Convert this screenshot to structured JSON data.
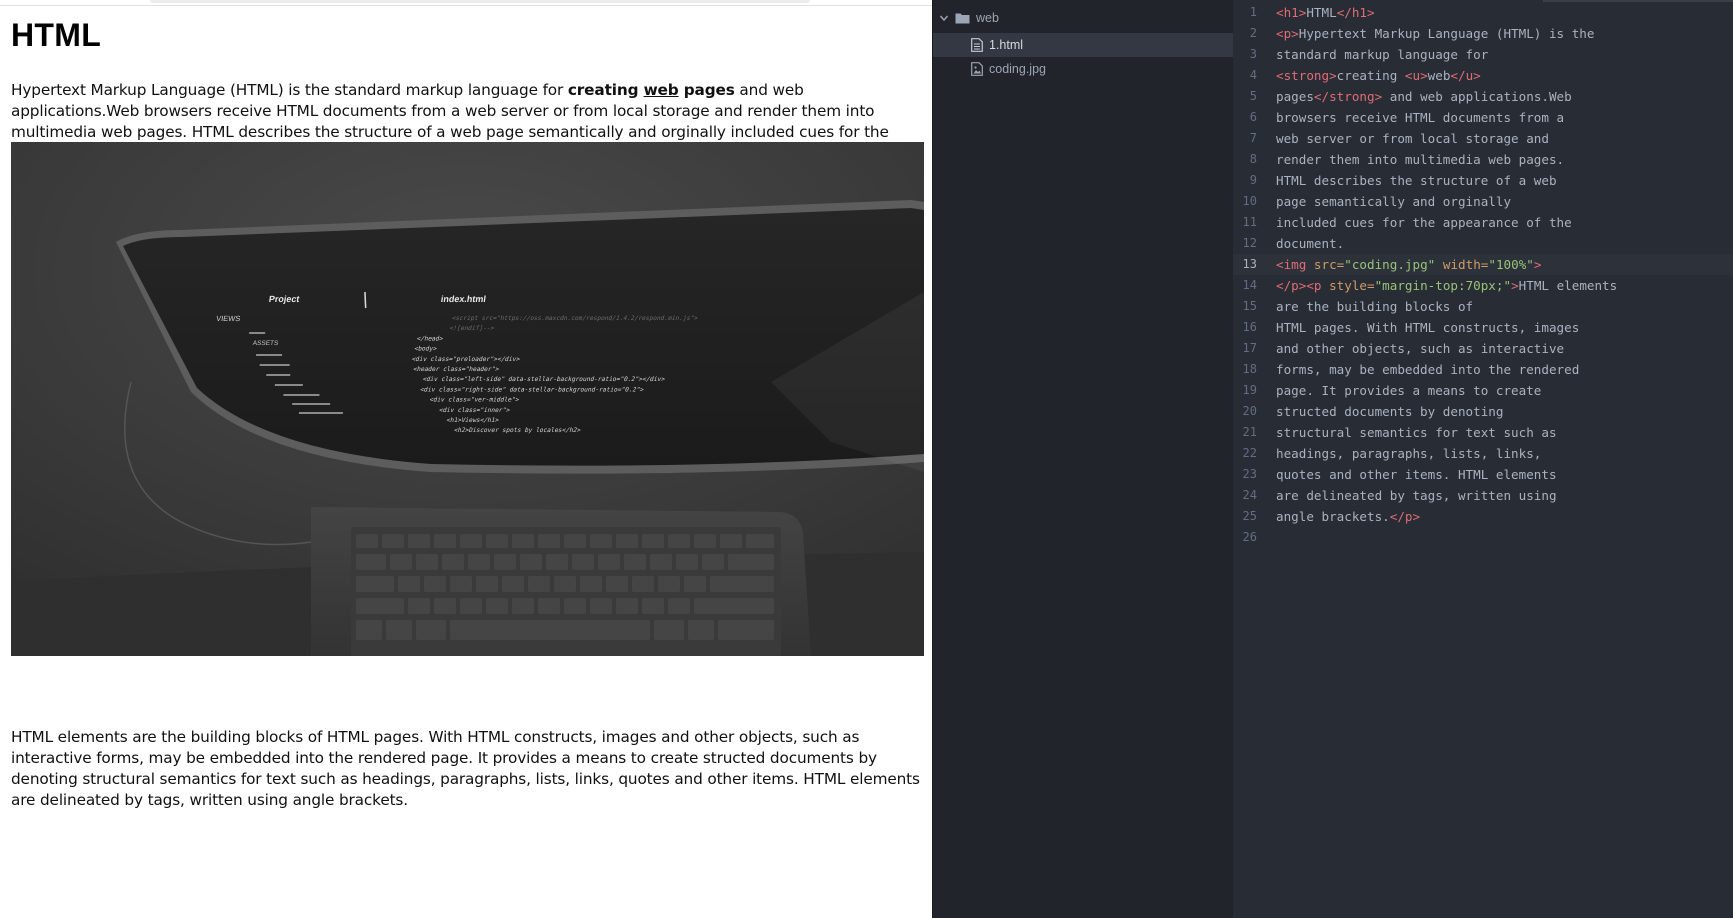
{
  "preview": {
    "title": "HTML",
    "para1": {
      "before": "Hypertext Markup Language (HTML) is the standard markup language for ",
      "strong_a": "creating ",
      "underlined": "web",
      "strong_b": " pages",
      "after": " and web applications.Web browsers receive HTML documents from a web server or from local storage and render them into multimedia web pages. HTML describes the structure of a web page semantically and orginally included cues for the appearance of the document."
    },
    "image_screen": {
      "project_label": "Project",
      "views_label": "VIEWS",
      "assets_label": "ASSETS",
      "file_label": "index.html",
      "code_lines": [
        "<script src=\"https://oss.maxcdn.com/respond/1.4.2/respond.min.js\">",
        "<![endif]-->",
        "</head>",
        "<body>",
        "<div class=\"preloader\"></div>",
        "<header class=\"header\">",
        "<div class=\"left-side\" data-stellar-background-ratio=\"0.2\"></div>",
        "<div class=\"right-side\" data-stellar-background-ratio=\"0.2\">",
        "<div class=\"ver-middle\">",
        "<div class=\"inner\">",
        "<h1>Views</h1>",
        "<h2>Discover spots by locales</h2>"
      ]
    },
    "para2": "HTML elements are the building blocks of HTML pages. With HTML constructs, images and other objects, such as interactive forms, may be embedded into the rendered page. It provides a means to create structed documents by denoting structural semantics for text such as headings, paragraphs, lists, links, quotes and other items. HTML elements are delineated by tags, written using angle brackets."
  },
  "tree": {
    "folder": "web",
    "files": [
      "1.html",
      "coding.jpg"
    ],
    "selected": "1.html"
  },
  "editor": {
    "active_line": 13,
    "lines": [
      {
        "n": "1",
        "segs": [
          [
            "t",
            "<h1>"
          ],
          [
            "x",
            "HTML"
          ],
          [
            "t",
            "</h1>"
          ]
        ]
      },
      {
        "n": "2",
        "segs": [
          [
            "t",
            "<p>"
          ],
          [
            "x",
            "Hypertext Markup Language (HTML) is the"
          ]
        ]
      },
      {
        "n": "3",
        "segs": [
          [
            "x",
            "standard markup language for"
          ]
        ]
      },
      {
        "n": "4",
        "segs": [
          [
            "t",
            "<strong>"
          ],
          [
            "x",
            "creating "
          ],
          [
            "t",
            "<u>"
          ],
          [
            "x",
            "web"
          ],
          [
            "t",
            "</u>"
          ]
        ]
      },
      {
        "n": "5",
        "segs": [
          [
            "x",
            "pages"
          ],
          [
            "t",
            "</strong>"
          ],
          [
            "x",
            " and web applications.Web"
          ]
        ]
      },
      {
        "n": "6",
        "segs": [
          [
            "x",
            "browsers receive HTML documents from a"
          ]
        ]
      },
      {
        "n": "7",
        "segs": [
          [
            "x",
            "web server or from local storage and"
          ]
        ]
      },
      {
        "n": "8",
        "segs": [
          [
            "x",
            "render them into multimedia web pages."
          ]
        ]
      },
      {
        "n": "9",
        "segs": [
          [
            "x",
            "HTML describes the structure of a web"
          ]
        ]
      },
      {
        "n": "10",
        "segs": [
          [
            "x",
            "page semantically and orginally"
          ]
        ]
      },
      {
        "n": "11",
        "segs": [
          [
            "x",
            "included cues for the appearance of the"
          ]
        ]
      },
      {
        "n": "12",
        "segs": [
          [
            "x",
            "document."
          ]
        ]
      },
      {
        "n": "13",
        "segs": [
          [
            "t",
            "<img "
          ],
          [
            "a",
            "src="
          ],
          [
            "s",
            "\"coding.jpg\""
          ],
          [
            "x",
            " "
          ],
          [
            "a",
            "width="
          ],
          [
            "s",
            "\"100%\""
          ],
          [
            "t",
            ">"
          ]
        ]
      },
      {
        "n": "14",
        "segs": [
          [
            "t",
            "</p><p "
          ],
          [
            "a",
            "style="
          ],
          [
            "s",
            "\"margin-top:70px;\""
          ],
          [
            "t",
            ">"
          ],
          [
            "x",
            "HTML elements"
          ]
        ]
      },
      {
        "n": "15",
        "segs": [
          [
            "x",
            "are the building blocks of"
          ]
        ]
      },
      {
        "n": "16",
        "segs": [
          [
            "x",
            "HTML pages. With HTML constructs, images"
          ]
        ]
      },
      {
        "n": "17",
        "segs": [
          [
            "x",
            "and other objects, such as interactive"
          ]
        ]
      },
      {
        "n": "18",
        "segs": [
          [
            "x",
            "forms, may be embedded into the rendered"
          ]
        ]
      },
      {
        "n": "19",
        "segs": [
          [
            "x",
            "page. It provides a means to create"
          ]
        ]
      },
      {
        "n": "20",
        "segs": [
          [
            "x",
            "structed documents by denoting"
          ]
        ]
      },
      {
        "n": "21",
        "segs": [
          [
            "x",
            "structural semantics for text such as"
          ]
        ]
      },
      {
        "n": "22",
        "segs": [
          [
            "x",
            "headings, paragraphs, lists, links,"
          ]
        ]
      },
      {
        "n": "23",
        "segs": [
          [
            "x",
            "quotes and other items. HTML elements"
          ]
        ]
      },
      {
        "n": "24",
        "segs": [
          [
            "x",
            "are delineated by tags, written using"
          ]
        ]
      },
      {
        "n": "25",
        "segs": [
          [
            "x",
            "angle brackets."
          ],
          [
            "t",
            "</p>"
          ]
        ]
      },
      {
        "n": "26",
        "segs": []
      }
    ]
  },
  "colors": {
    "tag": "#e06c75",
    "attribute": "#d19a66",
    "string": "#98c379",
    "text": "#abb2bf",
    "editor_bg": "#282c34",
    "tree_bg": "#21252b"
  }
}
